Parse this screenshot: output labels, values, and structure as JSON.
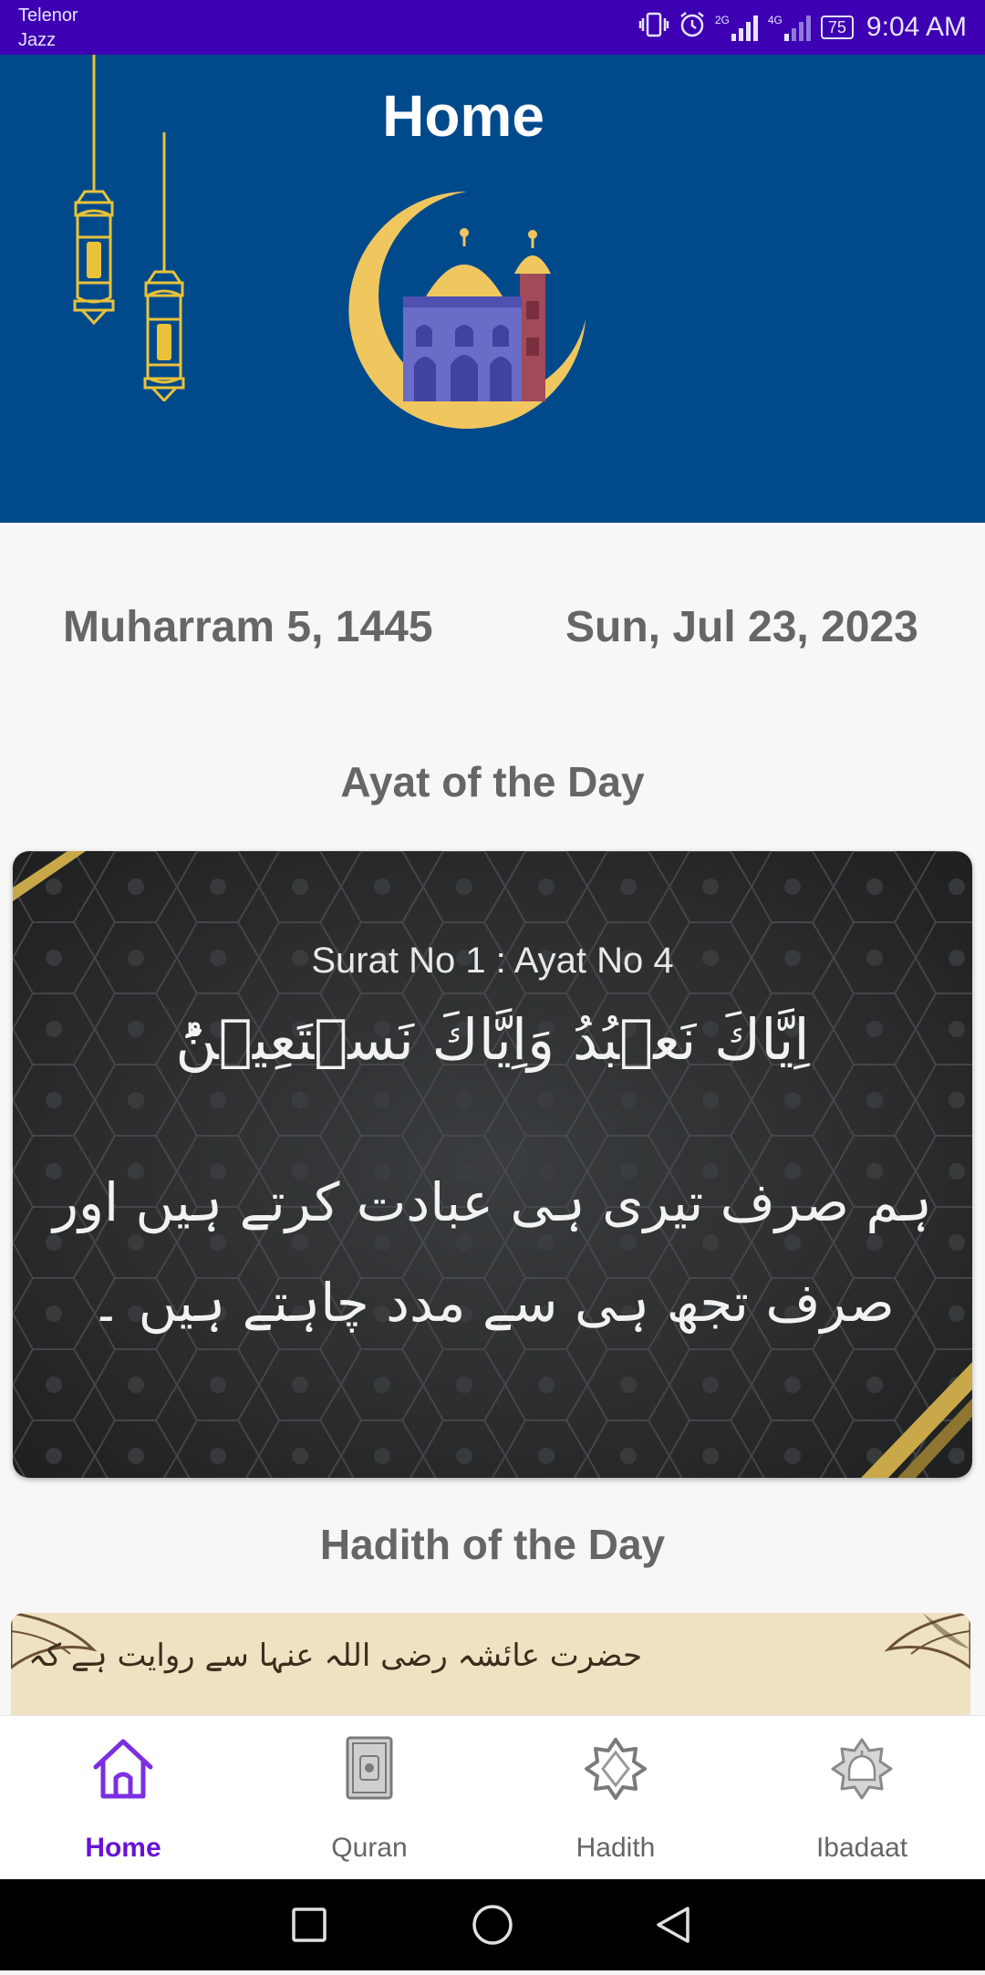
{
  "status_bar": {
    "carrier_1": "Telenor",
    "carrier_2": "Jazz",
    "network_1": "2G",
    "network_2": "4G",
    "battery": "75",
    "time": "9:04 AM"
  },
  "header": {
    "title": "Home",
    "bg_color": "#004a8c"
  },
  "dates": {
    "hijri": "Muharram 5, 1445",
    "gregorian": "Sun, Jul 23, 2023"
  },
  "ayat": {
    "section_title": "Ayat of the Day",
    "reference": "Surat No 1 : Ayat No 4",
    "arabic": "اِيَّاكَ نَعۡبُدُ وَاِيَّاكَ نَسۡتَعِيۡنُؕ",
    "urdu": "ہم صرف تیری ہی عبادت کرتے ہیں اور صرف تجھ ہی سے مدد چاہتے ہیں ۔"
  },
  "hadith": {
    "section_title": "Hadith of the Day",
    "preview_text": "حضرت عائشہ رضی اللہ عنہا سے روایت ہے کہ"
  },
  "bottom_nav": {
    "items": [
      {
        "label": "Home",
        "icon": "home-icon",
        "active": true
      },
      {
        "label": "Quran",
        "icon": "quran-book-icon",
        "active": false
      },
      {
        "label": "Hadith",
        "icon": "star-badge-icon",
        "active": false
      },
      {
        "label": "Ibadaat",
        "icon": "mosque-badge-icon",
        "active": false
      }
    ],
    "active_color": "#6a12d6"
  }
}
